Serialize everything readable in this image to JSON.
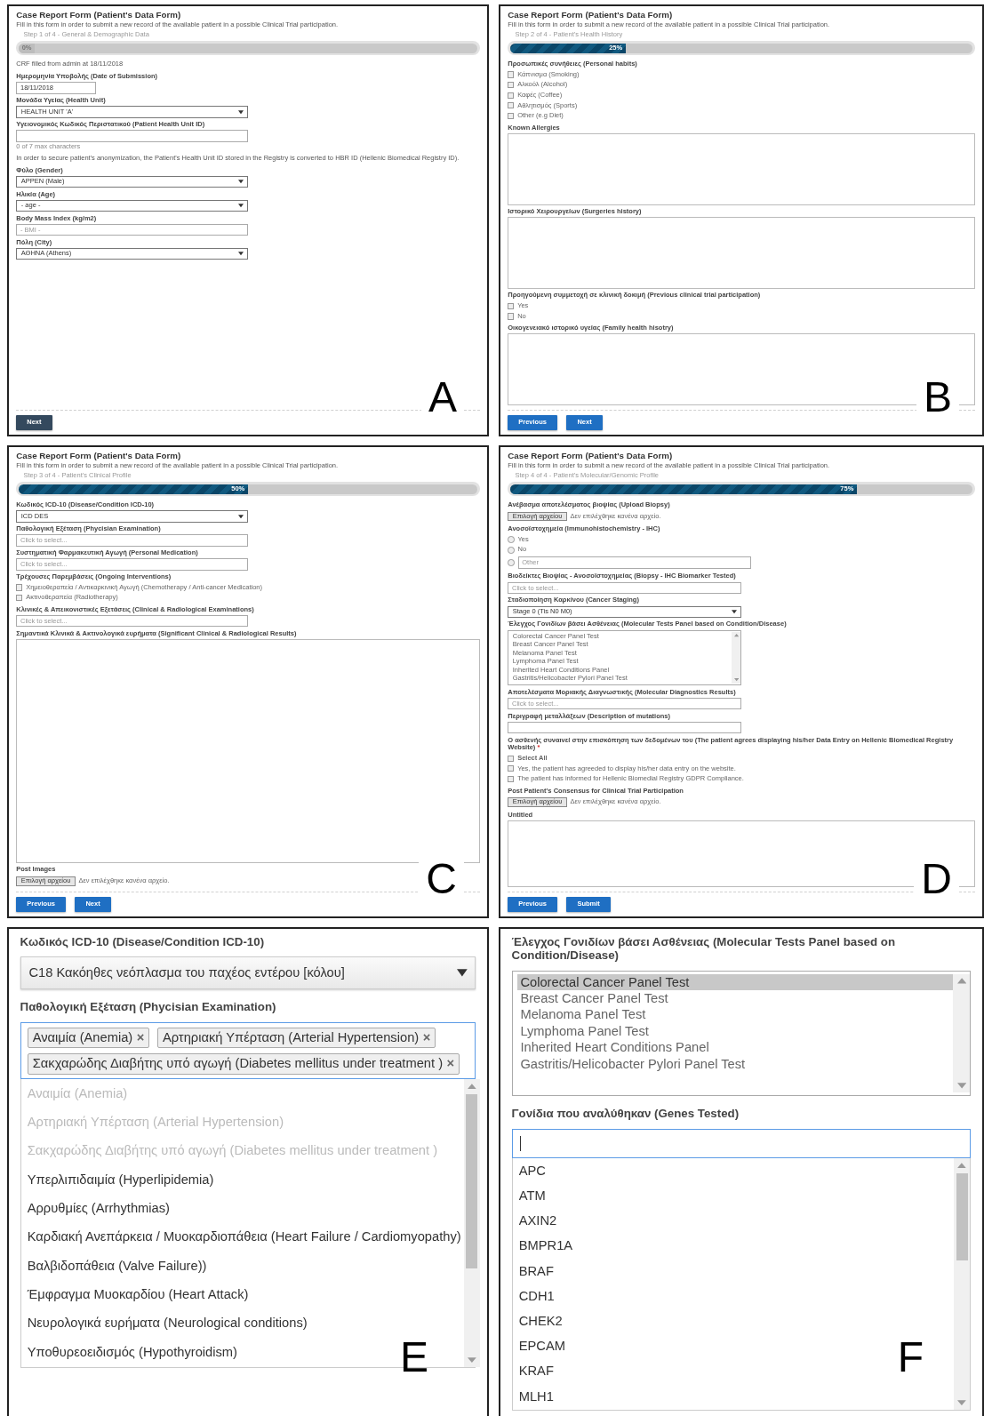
{
  "panels": [
    {
      "kind": "page",
      "letter": "A",
      "title": "Case Report Form (Patient's Data Form)",
      "description": "Fill in this form in order to submit a new record of the available patient in a possible Clinical Trial participation.",
      "step": "Step 1 of 4 - General & Demographic Data",
      "progress": {
        "level": 0,
        "label": "0%"
      },
      "fields": [
        {
          "kind": "text",
          "text": "CRF filled from admin at 18/11/2018"
        },
        {
          "kind": "label",
          "text": "Ημερομηνία Υποβολής (Date of Submission)"
        },
        {
          "kind": "date-input",
          "value": "18/11/2018"
        },
        {
          "kind": "label",
          "text": "Μονάδα Υγείας (Health Unit)"
        },
        {
          "kind": "select",
          "value": "HEALTH UNIT 'A'"
        },
        {
          "kind": "label",
          "text": "Υγειονομικός Κωδικός Περιστατικού (Patient Health Unit ID)"
        },
        {
          "kind": "input"
        },
        {
          "kind": "hint",
          "text": "0 of 7 max characters"
        },
        {
          "kind": "text",
          "text": "In order to secure patient's anonymization, the Patient's Health Unit ID stored in the Registry is converted to HBR ID (Hellenic Biomedical Registry ID)."
        },
        {
          "kind": "label",
          "text": "Φύλο (Gender)"
        },
        {
          "kind": "select",
          "value": "APPEN (Male)"
        },
        {
          "kind": "label",
          "text": "Ηλικία (Age)"
        },
        {
          "kind": "select",
          "value": "- age -"
        },
        {
          "kind": "label",
          "text": "Body Mass Index (kg/m2)"
        },
        {
          "kind": "input",
          "placeholder": "- BMI -"
        },
        {
          "kind": "label",
          "text": "Πόλη (City)"
        },
        {
          "kind": "select",
          "value": "ΑΘΗΝΑ (Athens)"
        }
      ],
      "buttons": [
        {
          "label": "Next",
          "kind": "dark"
        }
      ]
    },
    {
      "kind": "page",
      "letter": "B",
      "title": "Case Report Form (Patient's Data Form)",
      "description": "Fill in this form in order to submit a new record of the available patient in a possible Clinical Trial participation.",
      "step": "Step 2 of 4 - Patient's Health History",
      "progress": {
        "level": 0.25,
        "label": "25%"
      },
      "fields": [
        {
          "kind": "label",
          "text": "Προσωπικές συνήθειες (Personal habits)"
        },
        {
          "kind": "checkbox",
          "label": "Κάπνισμα (Smoking)",
          "checked": false
        },
        {
          "kind": "checkbox",
          "label": "Αλκοόλ (Alcohol)",
          "checked": false
        },
        {
          "kind": "checkbox",
          "label": "Καφές (Coffee)",
          "checked": false
        },
        {
          "kind": "checkbox",
          "label": "Αθλητισμός (Sports)",
          "checked": false
        },
        {
          "kind": "checkbox",
          "label": "Other (e.g Diet)",
          "checked": false
        },
        {
          "kind": "label",
          "text": "Known Allergies"
        },
        {
          "kind": "textarea"
        },
        {
          "kind": "label",
          "text": "Ιστορικό Χειρουργείων (Surgeries history)"
        },
        {
          "kind": "textarea"
        },
        {
          "kind": "label",
          "text": "Προηγούμενη συμμετοχή σε κλινική δοκιμή (Previous clinical trial participation)"
        },
        {
          "kind": "checkbox",
          "label": "Yes",
          "checked": false
        },
        {
          "kind": "checkbox",
          "label": "No",
          "checked": false
        },
        {
          "kind": "label",
          "text": "Οικογενειακό ιστορικό υγείας (Family health hisotry)"
        },
        {
          "kind": "textarea"
        }
      ],
      "buttons": [
        {
          "label": "Previous",
          "kind": "blue"
        },
        {
          "label": "Next",
          "kind": "blue"
        }
      ]
    },
    {
      "kind": "page",
      "letter": "C",
      "title": "Case Report Form (Patient's Data Form)",
      "description": "Fill in this form in order to submit a new record of the available patient in a possible Clinical Trial participation.",
      "step": "Step 3 of 4 - Patient's Clinical Profile",
      "progress": {
        "level": 0.5,
        "label": "50%"
      },
      "fields": [
        {
          "kind": "label",
          "text": "Κωδικός ICD-10 (Disease/Condition ICD-10)"
        },
        {
          "kind": "select",
          "value": "ICD DES"
        },
        {
          "kind": "label",
          "text": "Παθολογική Εξέταση (Phycisian Examination)"
        },
        {
          "kind": "input",
          "placeholder": "Click to select..."
        },
        {
          "kind": "label",
          "text": "Συστηματική Φαρμακευτική Αγωγή (Personal Medication)"
        },
        {
          "kind": "input",
          "placeholder": "Click to select..."
        },
        {
          "kind": "label",
          "text": "Τρέχουσες Παρεμβάσεις (Ongoing Interventions)"
        },
        {
          "kind": "checkbox",
          "label": "Χημειοθεραπεία / Αντικαρκινική Αγωγή (Chemotherapy / Anti-cancer Medication)",
          "checked": false
        },
        {
          "kind": "checkbox",
          "label": "Ακτινοθεραπεία (Radiotherapy)",
          "checked": false
        },
        {
          "kind": "label",
          "text": "Κλινικές & Απεικονιστικές Εξετάσεις (Clinical & Radiological Examinations)"
        },
        {
          "kind": "input",
          "placeholder": "Click to select..."
        },
        {
          "kind": "label",
          "text": "Σημαντικά Κλινικά & Ακτινολογικά ευρήματα (Significant Clinical & Radiological Results)"
        },
        {
          "kind": "textarea"
        },
        {
          "kind": "label",
          "text": "Post Images"
        },
        {
          "kind": "file",
          "button": "Επιλογή αρχείου",
          "status": "Δεν επιλέχθηκε κανένα αρχείο."
        }
      ],
      "buttons": [
        {
          "label": "Previous",
          "kind": "blue"
        },
        {
          "label": "Next",
          "kind": "blue"
        }
      ]
    },
    {
      "kind": "page",
      "letter": "D",
      "title": "Case Report Form (Patient's Data Form)",
      "description": "Fill in this form in order to submit a new record of the available patient in a possible Clinical Trial participation.",
      "step": "Step 4 of 4 - Patient's Molecular/Genomic Profile",
      "progress": {
        "level": 0.75,
        "label": "75%"
      },
      "fields": [
        {
          "kind": "label",
          "text": "Ανέβασμα αποτελέσματος βιοψίας (Upload Biopsy)"
        },
        {
          "kind": "file",
          "button": "Επιλογή αρχείου",
          "status": "Δεν επιλέχθηκε κανένα αρχείο."
        },
        {
          "kind": "label",
          "text": "Ανοσοϊστοχημεία (Immunohistochemistry - IHC)"
        },
        {
          "kind": "radio",
          "label": "Yes",
          "selected": false
        },
        {
          "kind": "radio",
          "label": "No",
          "selected": false
        },
        {
          "kind": "radio-input",
          "placeholder": "Other",
          "selected": false
        },
        {
          "kind": "label",
          "text": "Βιοδείκτες Βιοψίας - Ανοσοϊστοχημείας (Biopsy - IHC Biomarker Tested)"
        },
        {
          "kind": "input",
          "placeholder": "Click to select..."
        },
        {
          "kind": "label",
          "text": "Σταδιοποίηση Καρκίνου (Cancer Staging)"
        },
        {
          "kind": "select",
          "value": "Stage 0 (Tis N0 M0)"
        },
        {
          "kind": "label",
          "text": "Έλεγχος Γονιδίων βάσει Ασθένειας (Molecular Tests Panel based on Condition/Disease)"
        },
        {
          "kind": "listbox",
          "items": [
            {
              "label": "Colorectal Cancer Panel Test",
              "selected": false
            },
            {
              "label": "Breast Cancer Panel Test",
              "selected": false
            },
            {
              "label": "Melanoma Panel Test",
              "selected": false
            },
            {
              "label": "Lymphoma Panel Test",
              "selected": false
            },
            {
              "label": "Inherited Heart Conditions Panel",
              "selected": false
            },
            {
              "label": "Gastritis/Helicobacter Pylori Panel Test",
              "selected": false
            }
          ]
        },
        {
          "kind": "label",
          "text": "Αποτελέσματα Μοριακής Διαγνωστικής (Molecular Diagnostics Results)"
        },
        {
          "kind": "input",
          "placeholder": "Click to select..."
        },
        {
          "kind": "label",
          "text": "Περιγραφή μεταλλάξεων (Description of mutations)"
        },
        {
          "kind": "input"
        },
        {
          "kind": "label",
          "text": "Ο ασθενής συναινεί στην επισκόπηση των δεδομένων του (The patient agrees displaying his/her Data Entry on Hellenic Biomedical Registry Website)",
          "marker": "*"
        },
        {
          "kind": "select-all",
          "label": "Select All",
          "checked": false
        },
        {
          "kind": "checkbox",
          "label": "Yes, the patient has agreeded to display his/her data entry on the website.",
          "checked": false
        },
        {
          "kind": "checkbox",
          "label": "The patient has informed for Hellenic Biomedial Registry GDPR Compliance.",
          "checked": false
        },
        {
          "kind": "label",
          "text": "Post Patient's Consensus for Clinical Trial Participation"
        },
        {
          "kind": "file",
          "button": "Επιλογή αρχείου",
          "status": "Δεν επιλέχθηκε κανένα αρχείο."
        },
        {
          "kind": "label",
          "text": "Untitled"
        },
        {
          "kind": "textarea"
        }
      ],
      "buttons": [
        {
          "label": "Previous",
          "kind": "blue"
        },
        {
          "label": "Submit",
          "kind": "blue"
        }
      ]
    },
    {
      "kind": "zoom",
      "letter": "E",
      "fields": [
        {
          "kind": "label",
          "text": "Κωδικός ICD-10 (Disease/Condition ICD-10)"
        },
        {
          "kind": "select",
          "value": "C18 Κακόηθες νεόπλασμα του παχέος εντέρου [κόλου]"
        },
        {
          "kind": "label",
          "text": "Παθολογική Εξέταση (Phycisian Examination)"
        },
        {
          "kind": "multiselect",
          "tags": [
            {
              "label": "Αναιμία (Anemia)",
              "remove": "×"
            },
            {
              "label": "Αρτηριακή Υπέρταση (Arterial Hypertension)",
              "remove": "×"
            },
            {
              "label": "Σακχαρώδης Διαβήτης υπό αγωγή (Diabetes mellitus under treatment )",
              "remove": "×"
            }
          ],
          "options": [
            {
              "label": "Αναιμία (Anemia)",
              "disabled": true
            },
            {
              "label": "Αρτηριακή Υπέρταση (Arterial Hypertension)",
              "disabled": true
            },
            {
              "label": "Σακχαρώδης Διαβήτης υπό αγωγή (Diabetes mellitus under treatment )",
              "disabled": true
            },
            {
              "label": "Υπερλιπιδαιμία (Hyperlipidemia)",
              "disabled": false
            },
            {
              "label": "Αρρυθμίες (Arrhythmias)",
              "disabled": false
            },
            {
              "label": "Καρδιακή Ανεπάρκεια / Μυοκαρδιοπάθεια (Heart Failure / Cardiomyopathy)",
              "disabled": false
            },
            {
              "label": "Βαλβιδοπάθεια (Valve Failure))",
              "disabled": false
            },
            {
              "label": "Έμφραγμα Μυοκαρδίου (Heart Attack)",
              "disabled": false
            },
            {
              "label": "Νευρολογικά ευρήματα (Neurological conditions)",
              "disabled": false
            },
            {
              "label": "Υποθυρεοειδισμός (Hypothyroidism)",
              "disabled": false
            }
          ]
        }
      ]
    },
    {
      "kind": "zoom",
      "letter": "F",
      "fields": [
        {
          "kind": "label",
          "text": "Έλεγχος Γονιδίων βάσει Ασθένειας (Molecular Tests Panel based on Condition/Disease)"
        },
        {
          "kind": "listbox",
          "items": [
            {
              "label": "Colorectal Cancer Panel Test",
              "selected": true
            },
            {
              "label": "Breast Cancer Panel Test",
              "selected": false
            },
            {
              "label": "Melanoma Panel Test",
              "selected": false
            },
            {
              "label": "Lymphoma Panel Test",
              "selected": false
            },
            {
              "label": "Inherited Heart Conditions Panel",
              "selected": false
            },
            {
              "label": "Gastritis/Helicobacter Pylori Panel Test",
              "selected": false
            }
          ]
        },
        {
          "kind": "label",
          "text": "Γονίδια που αναλύθηκαν (Genes Tested)"
        },
        {
          "kind": "search-dropdown",
          "options": [
            "APC",
            "ATM",
            "AXIN2",
            "BMPR1A",
            "BRAF",
            "CDH1",
            "CHEK2",
            "EPCAM",
            "KRAF",
            "MLH1"
          ]
        }
      ]
    }
  ]
}
